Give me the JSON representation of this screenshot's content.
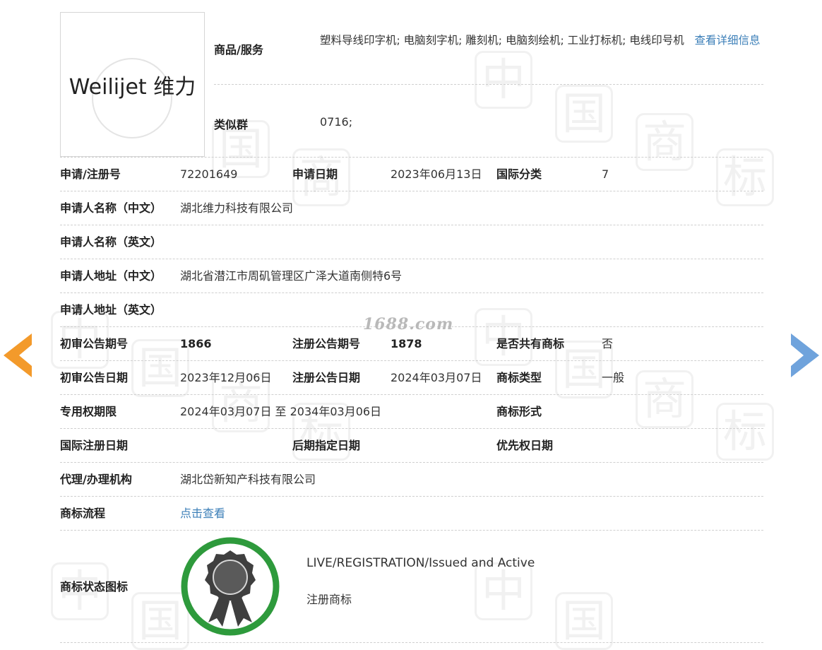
{
  "logo": {
    "text": "Weilijet  维力"
  },
  "goods": {
    "label": "商品/服务",
    "value": "塑料导线印字机; 电脑刻字机; 雕刻机; 电脑刻绘机; 工业打标机; 电线印号机",
    "more_link": "查看详细信息"
  },
  "similar": {
    "label": "类似群",
    "value": "0716;"
  },
  "rows": {
    "reg_no": {
      "label": "申请/注册号",
      "value": "72201649"
    },
    "apply_date": {
      "label": "申请日期",
      "value": "2023年06月13日"
    },
    "intl_class": {
      "label": "国际分类",
      "value": "7"
    },
    "applicant_cn": {
      "label": "申请人名称（中文）",
      "value": "湖北维力科技有限公司"
    },
    "applicant_en": {
      "label": "申请人名称（英文）",
      "value": ""
    },
    "address_cn": {
      "label": "申请人地址（中文）",
      "value": "湖北省潜江市周矶管理区广泽大道南侧特6号"
    },
    "address_en": {
      "label": "申请人地址（英文）",
      "value": ""
    },
    "prelim_issue": {
      "label": "初审公告期号",
      "value": "1866"
    },
    "reg_issue": {
      "label": "注册公告期号",
      "value": "1878"
    },
    "shared": {
      "label": "是否共有商标",
      "value": "否"
    },
    "prelim_date": {
      "label": "初审公告日期",
      "value": "2023年12月06日"
    },
    "reg_date": {
      "label": "注册公告日期",
      "value": "2024年03月07日"
    },
    "tm_type": {
      "label": "商标类型",
      "value": "一般"
    },
    "exclusive": {
      "label": "专用权期限",
      "value": "2024年03月07日 至 2034年03月06日"
    },
    "tm_form": {
      "label": "商标形式",
      "value": ""
    },
    "intl_reg_date": {
      "label": "国际注册日期",
      "value": ""
    },
    "later_date": {
      "label": "后期指定日期",
      "value": ""
    },
    "priority_date": {
      "label": "优先权日期",
      "value": ""
    },
    "agency": {
      "label": "代理/办理机构",
      "value": "湖北岱新知产科技有限公司"
    },
    "process": {
      "label": "商标流程",
      "link": "点击查看"
    },
    "status": {
      "label": "商标状态图标",
      "en": "LIVE/REGISTRATION/Issued and Active",
      "cn": "注册商标"
    }
  },
  "watermark": {
    "site": "1688.com",
    "chars": [
      "中",
      "国",
      "商",
      "标"
    ]
  },
  "colors": {
    "link": "#3c7fb8",
    "arrow_left": "#f39a2b",
    "arrow_right": "#6fa3dc",
    "badge_ring": "#2e9a3c"
  }
}
